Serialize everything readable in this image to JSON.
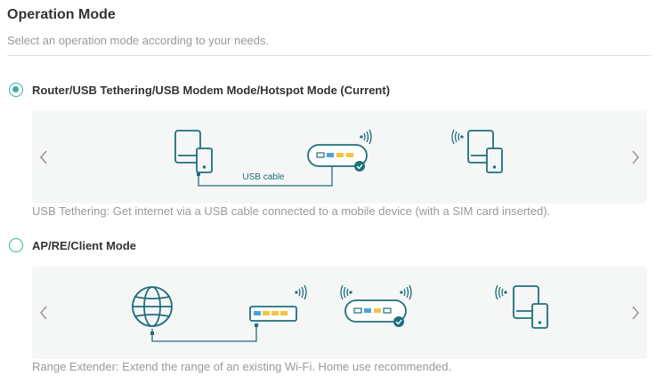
{
  "header": {
    "title": "Operation Mode",
    "subtitle": "Select an operation mode according to your needs."
  },
  "modes": [
    {
      "label": "Router/USB Tethering/USB Modem Mode/Hotspot Mode (Current)",
      "selected": true,
      "diagram_text": "USB cable",
      "description": "USB Tethering: Get internet via a USB cable connected to a mobile device (with a SIM card inserted)."
    },
    {
      "label": "AP/RE/Client Mode",
      "selected": false,
      "description": "Range Extender: Extend the range of an existing Wi-Fi. Home use recommended."
    }
  ],
  "colors": {
    "accent": "#36b1a6",
    "icon": "#1f6f7c",
    "port_yellow": "#f5c342",
    "port_blue": "#4aa3df",
    "panel_bg": "#f5f6f6"
  }
}
